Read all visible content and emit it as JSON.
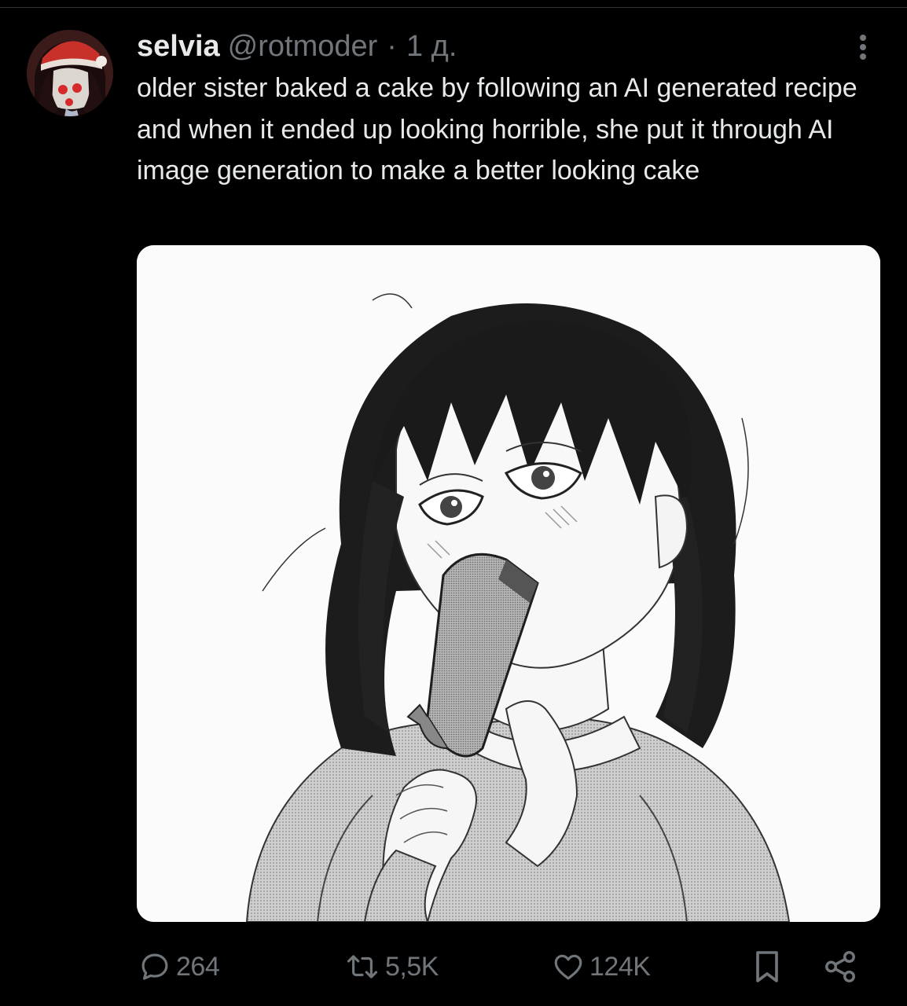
{
  "tweet": {
    "author": {
      "display_name": "selvia",
      "handle": "@rotmoder",
      "separator": "·",
      "timestamp": "1 д."
    },
    "text": "older sister baked a cake by following an AI generated recipe and when it ended up looking horrible, she put it through AI image generation to make a better looking cake",
    "media": {
      "description_icon": "manga-illustration-image"
    }
  },
  "actions": {
    "reply_count": "264",
    "retweet_count": "5,5K",
    "like_count": "124K"
  },
  "icons": {
    "reply": "speech-bubble-icon",
    "retweet": "retweet-arrows-icon",
    "like": "heart-icon",
    "bookmark": "bookmark-icon",
    "share": "share-nodes-icon",
    "more": "vertical-dots-icon"
  },
  "colors": {
    "background": "#000000",
    "primary_text": "#e7e9ea",
    "secondary_text": "#71767b",
    "divider": "#2f3336"
  }
}
